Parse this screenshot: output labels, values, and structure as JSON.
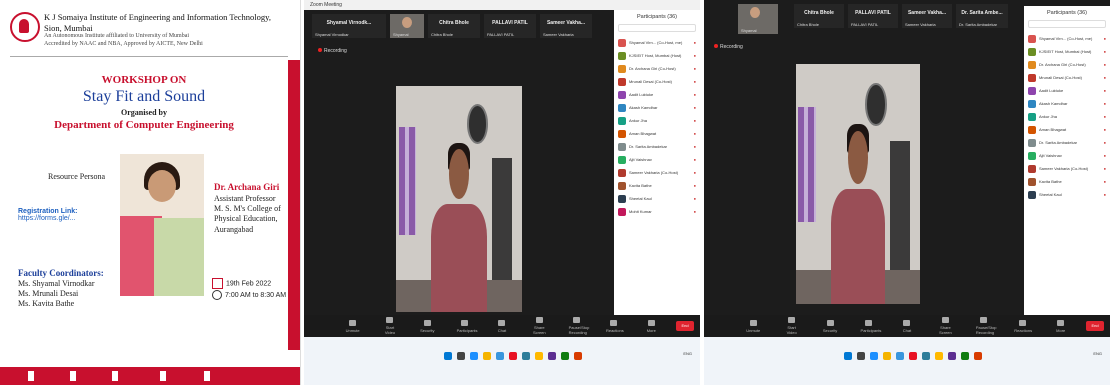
{
  "poster": {
    "institute": "K J Somaiya Institute of Engineering and Information Technology, Sion, Mumbai",
    "affiliation": "An Autonomous Institute affiliated to University of Mumbai",
    "accreditation": "Accredited by NAAC and NBA, Approved by AICTE, New Delhi",
    "workshop_label": "WORKSHOP ON",
    "workshop_title": "Stay Fit and Sound",
    "organised_by": "Organised by",
    "department": "Department of Computer Engineering",
    "resource_person_label": "Resource Persona",
    "registration_label": "Registration Link:",
    "registration_url": "https://forms.gle/...",
    "speaker_name": "Dr. Archana Giri",
    "speaker_title": "Assistant Professor",
    "speaker_college": "M. S. M's College of Physical Education,",
    "speaker_city": "Aurangabad",
    "coordinators_title": "Faculty Coordinators:",
    "coordinators": [
      "Ms. Shyamal Virnodkar",
      "Ms. Mrunali Desai",
      "Ms. Kavita Bathe"
    ],
    "date": "19th Feb 2022",
    "time": "7:00 AM to 8:30 AM"
  },
  "zoom1": {
    "window_title": "Zoom Meeting",
    "tiles": [
      {
        "label": "Shyamal Virnodk...",
        "name": "Shyamal Virnodkar",
        "video": false
      },
      {
        "label": "",
        "name": "Shyamal",
        "video": true
      },
      {
        "label": "Chitra Bhole",
        "name": "Chitra Bhole",
        "video": false
      },
      {
        "label": "PALLAVI PATIL",
        "name": "PALLAVI PATIL",
        "video": false
      },
      {
        "label": "Sameer Vakha...",
        "name": "Sameer Vakharia",
        "video": false
      }
    ],
    "recording": "Recording",
    "participants_header": "Participants (36)",
    "participants": [
      "Shyamal Virn... (Co-Host, me)",
      "KJSIEIT Host, Mumbai (Host)",
      "Dr. Archana Giri (Co-Host)",
      "Mrunali Desai (Co-Host)",
      "Aadit Luktuke",
      "Akash Kamdhar",
      "Ankur Jha",
      "Aman Bhagwat",
      "Dr. Sarita Ambadekar",
      "Ajit Vaishnav",
      "Sameer Vakharia (Co-Host)",
      "Kavita Bathe",
      "Sheetal Kaul",
      "Mohit Kumar"
    ],
    "participant_buttons": [
      "Invite",
      "Mute All"
    ],
    "toolbar": [
      "Unmute",
      "Start Video",
      "Security",
      "Participants",
      "Chat",
      "Share Screen",
      "Pause/Stop Recording",
      "Reactions",
      "More"
    ],
    "leave": "End"
  },
  "zoom2": {
    "tiles": [
      {
        "label": "",
        "name": "Shyamal",
        "video": true
      },
      {
        "label": "Chitra Bhole",
        "name": "Chitra Bhole",
        "video": false
      },
      {
        "label": "PALLAVI PATIL",
        "name": "PALLAVI PATIL",
        "video": false
      },
      {
        "label": "Sameer Vakha...",
        "name": "Sameer Vakharia",
        "video": false
      },
      {
        "label": "Dr. Sarita Ambe...",
        "name": "Dr. Sarita Ambadekar",
        "video": false
      }
    ],
    "recording": "Recording",
    "participants_header": "Participants (36)",
    "participants": [
      "Shyamal Virn... (Co-Host, me)",
      "KJSIEIT Host, Mumbai (Host)",
      "Dr. Archana Giri (Co-Host)",
      "Mrunali Desai (Co-Host)",
      "Aadit Luktuke",
      "Akash Kamdhar",
      "Ankur Jha",
      "Aman Bhagwat",
      "Dr. Sarita Ambadekar",
      "Ajit Vaishnav",
      "Sameer Vakharia (Co-Host)",
      "Kavita Bathe",
      "Sheetal Kaul"
    ],
    "participant_buttons": [
      "Invite",
      "Mute All"
    ],
    "toolbar": [
      "Unmute",
      "Start Video",
      "Security",
      "Participants",
      "Chat",
      "Share Screen",
      "Pause/Stop Recording",
      "Reactions",
      "More"
    ],
    "leave": "End"
  },
  "avatar_colors": [
    "#d9534f",
    "#6b8e23",
    "#e08a1e",
    "#c0392b",
    "#8e44ad",
    "#2e86c1",
    "#16a085",
    "#d35400",
    "#7f8c8d",
    "#27ae60",
    "#b03a2e",
    "#a0522d",
    "#2c3e50",
    "#c2185b"
  ]
}
